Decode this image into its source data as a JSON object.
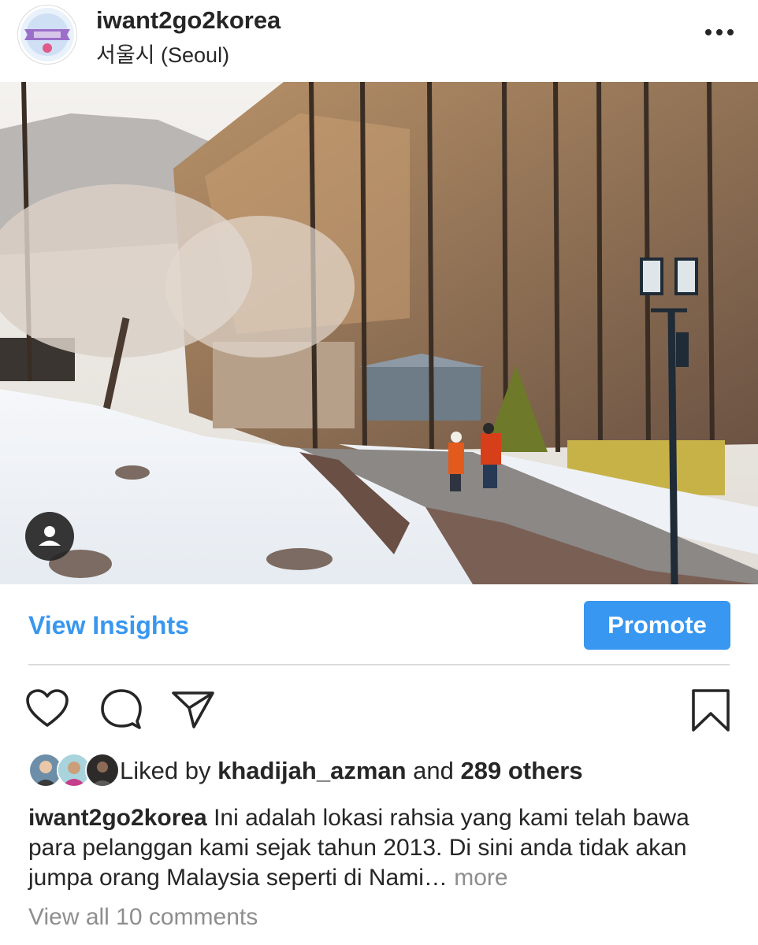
{
  "post": {
    "username": "iwant2go2korea",
    "location": "서울시 (Seoul)",
    "avatar_logo_text": "I WANT KOREA",
    "menu_icon": "more-horizontal-icon",
    "photo_alt": "photo",
    "tag_icon": "user-tag-icon"
  },
  "insights": {
    "view_insights_label": "View Insights",
    "promote_label": "Promote",
    "accent_color": "#3897f0"
  },
  "actions": {
    "like_icon": "heart-icon",
    "comment_icon": "comment-icon",
    "share_icon": "share-icon",
    "save_icon": "bookmark-icon"
  },
  "likes": {
    "prefix": "Liked by ",
    "first_liker": "khadijah_azman",
    "middle": " and ",
    "others": "289 others"
  },
  "caption": {
    "username": "iwant2go2korea",
    "text": " Ini adalah lokasi rahsia yang kami telah bawa para pelanggan kami sejak tahun 2013. Di sini anda tidak akan jumpa orang Malaysia seperti di Nami…",
    "more_label": " more"
  },
  "comments": {
    "view_all_label": "View all 10 comments"
  }
}
